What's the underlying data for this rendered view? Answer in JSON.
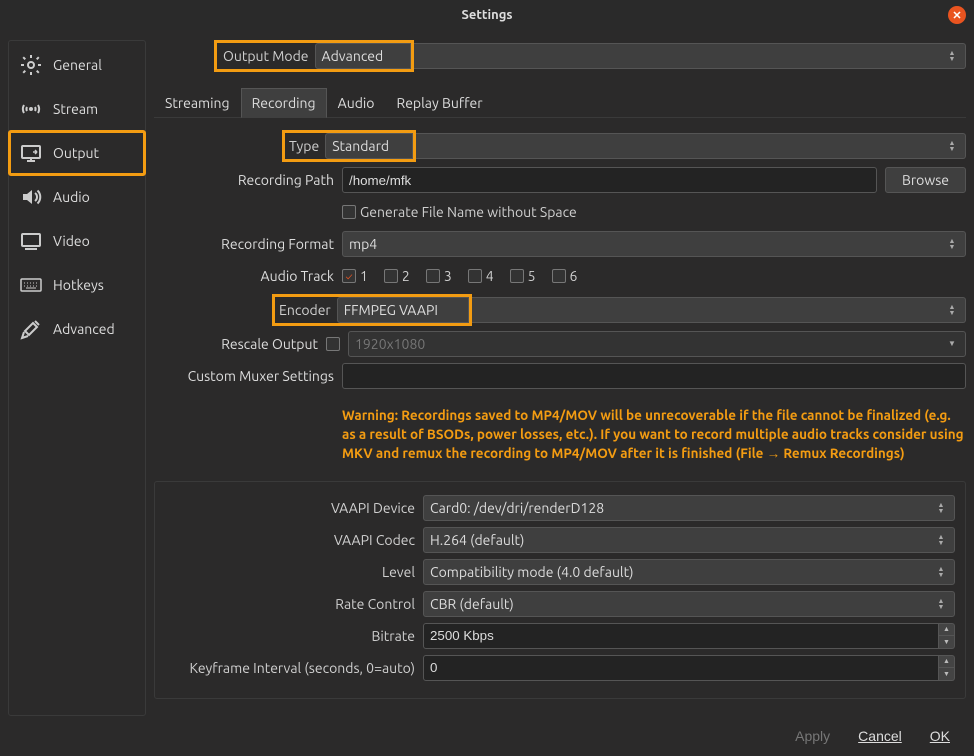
{
  "window": {
    "title": "Settings"
  },
  "sidebar": {
    "items": [
      {
        "label": "General"
      },
      {
        "label": "Stream"
      },
      {
        "label": "Output"
      },
      {
        "label": "Audio"
      },
      {
        "label": "Video"
      },
      {
        "label": "Hotkeys"
      },
      {
        "label": "Advanced"
      }
    ]
  },
  "output_mode": {
    "label": "Output Mode",
    "value": "Advanced"
  },
  "tabs": {
    "streaming": "Streaming",
    "recording": "Recording",
    "audio": "Audio",
    "replay_buffer": "Replay Buffer"
  },
  "form": {
    "type_label": "Type",
    "type_value": "Standard",
    "recording_path_label": "Recording Path",
    "recording_path_value": "/home/mfk",
    "browse": "Browse",
    "generate_filename": "Generate File Name without Space",
    "recording_format_label": "Recording Format",
    "recording_format_value": "mp4",
    "audio_track_label": "Audio Track",
    "tracks": [
      "1",
      "2",
      "3",
      "4",
      "5",
      "6"
    ],
    "encoder_label": "Encoder",
    "encoder_value": "FFMPEG VAAPI",
    "rescale_label": "Rescale Output",
    "rescale_value": "1920x1080",
    "muxer_label": "Custom Muxer Settings",
    "warning": "Warning: Recordings saved to MP4/MOV will be unrecoverable if the file cannot be finalized (e.g. as a result of BSODs, power losses, etc.). If you want to record multiple audio tracks consider using MKV and remux the recording to MP4/MOV after it is finished (File → Remux Recordings)"
  },
  "encoder_panel": {
    "vaapi_device_label": "VAAPI Device",
    "vaapi_device_value": "Card0: /dev/dri/renderD128",
    "vaapi_codec_label": "VAAPI Codec",
    "vaapi_codec_value": "H.264 (default)",
    "level_label": "Level",
    "level_value": "Compatibility mode  (4.0 default)",
    "rate_control_label": "Rate Control",
    "rate_control_value": "CBR (default)",
    "bitrate_label": "Bitrate",
    "bitrate_value": "2500 Kbps",
    "keyframe_label": "Keyframe Interval (seconds, 0=auto)",
    "keyframe_value": "0"
  },
  "buttons": {
    "apply": "Apply",
    "cancel": "Cancel",
    "ok": "OK"
  }
}
